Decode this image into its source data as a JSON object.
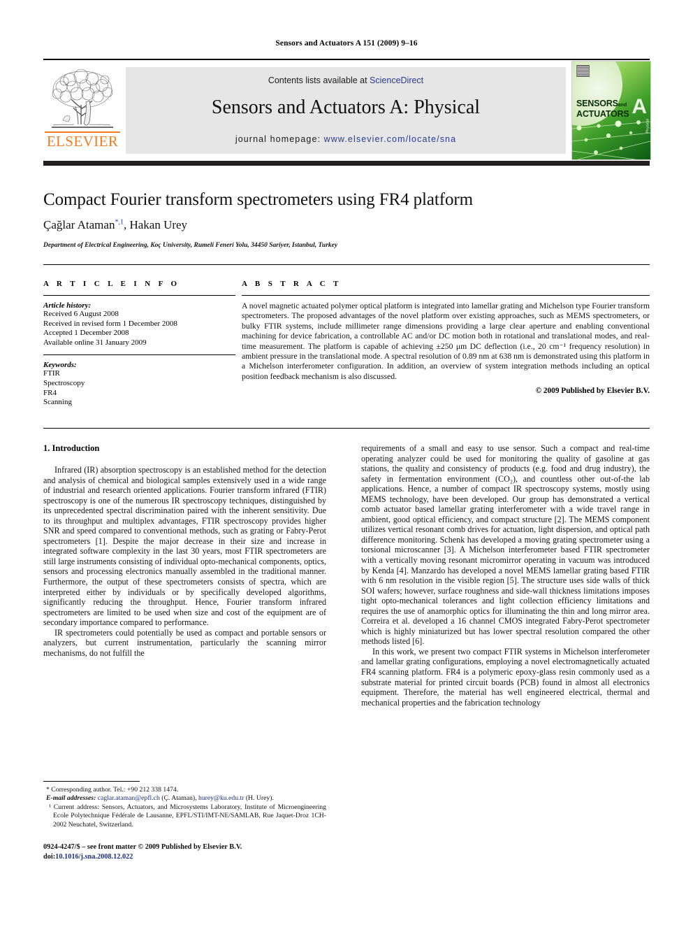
{
  "running_head": "Sensors and Actuators A 151 (2009) 9–16",
  "masthead": {
    "contents_prefix": "Contents lists available at ",
    "sciencedirect": "ScienceDirect",
    "journal_title": "Sensors and Actuators A: Physical",
    "homepage_prefix": "journal homepage: ",
    "homepage_url": "www.elsevier.com/locate/sna",
    "publisher_logo_text": "ELSEVIER",
    "cover": {
      "line1": "SENSORS",
      "line1_small": "and",
      "line2": "ACTUATORS",
      "letter": "A",
      "sub": "Physical"
    },
    "colors": {
      "link": "#2b3b8f",
      "elsevier_orange": "#f47c20",
      "box_gray": "#e6e6e6"
    }
  },
  "article": {
    "title": "Compact Fourier transform spectrometers using FR4 platform",
    "authors_html": "Çağlar Ataman<sup class=\"star\">*,1</sup>, Hakan Urey",
    "authors_plain": "Çağlar Ataman*,1, Hakan Urey",
    "affiliation": "Department of Electrical Engineering, Koç University, Rumeli Feneri Yolu, 34450 Sariyer, Istanbul, Turkey"
  },
  "info": {
    "heading": "A R T I C L E   I N F O",
    "history_label": "Article history:",
    "history": [
      "Received 6 August 2008",
      "Received in revised form 1 December 2008",
      "Accepted 1 December 2008",
      "Available online 31 January 2009"
    ],
    "keywords_label": "Keywords:",
    "keywords": [
      "FTIR",
      "Spectroscopy",
      "FR4",
      "Scanning"
    ]
  },
  "abstract": {
    "heading": "A B S T R A C T",
    "text": "A novel magnetic actuated polymer optical platform is integrated into lamellar grating and Michelson type Fourier transform spectrometers. The proposed advantages of the novel platform over existing approaches, such as MEMS spectrometers, or bulky FTIR systems, include millimeter range dimensions providing a large clear aperture and enabling conventional machining for device fabrication, a controllable AC and/or DC motion both in rotational and translational modes, and real-time measurement. The platform is capable of achieving ±250 μm DC deflection (i.e., 20 cm⁻¹ frequency resolution) in ambient pressure in the translational mode. A spectral resolution of 0.89 nm at 638 nm is demonstrated using this platform in a Michelson interferometer configuration. In addition, an overview of system integration methods including an optical position feedback mechanism is also discussed.",
    "copyright": "© 2009 Published by Elsevier B.V."
  },
  "body": {
    "section1_title": "1. Introduction",
    "left_paragraphs": [
      "Infrared (IR) absorption spectroscopy is an established method for the detection and analysis of chemical and biological samples extensively used in a wide range of industrial and research oriented applications. Fourier transform infrared (FTIR) spectroscopy is one of the numerous IR spectroscopy techniques, distinguished by its unprecedented spectral discrimination paired with the inherent sensitivity. Due to its throughput and multiplex advantages, FTIR spectroscopy provides higher SNR and speed compared to conventional methods, such as grating or Fabry-Perot spectrometers [1]. Despite the major decrease in their size and increase in integrated software complexity in the last 30 years, most FTIR spectrometers are still large instruments consisting of individual opto-mechanical components, optics, sensors and processing electronics manually assembled in the traditional manner. Furthermore, the output of these spectrometers consists of spectra, which are interpreted either by individuals or by specifically developed algorithms, significantly reducing the throughput. Hence, Fourier transform infrared spectrometers are limited to be used when size and cost of the equipment are of secondary importance compared to performance.",
      "IR spectrometers could potentially be used as compact and portable sensors or analyzers, but current instrumentation, particularly the scanning mirror mechanisms, do not fulfill the"
    ],
    "right_paragraphs": [
      "requirements of a small and easy to use sensor. Such a compact and real-time operating analyzer could be used for monitoring the quality of gasoline at gas stations, the quality and consistency of products (e.g. food and drug industry), the safety in fermentation environment (CO₂), and countless other out-of-the lab applications. Hence, a number of compact IR spectroscopy systems, mostly using MEMS technology, have been developed. Our group has demonstrated a vertical comb actuator based lamellar grating interferometer with a wide travel range in ambient, good optical efficiency, and compact structure [2]. The MEMS component utilizes vertical resonant comb drives for actuation, light dispersion, and optical path difference monitoring. Schenk has developed a moving grating spectrometer using a torsional microscanner [3]. A Michelson interferometer based FTIR spectrometer with a vertically moving resonant micromirror operating in vacuum was introduced by Kenda [4]. Manzardo has developed a novel MEMS lamellar grating based FTIR with 6 nm resolution in the visible region [5]. The structure uses side walls of thick SOI wafers; however, surface roughness and side-wall thickness limitations imposes tight opto-mechanical tolerances and light collection efficiency limitations and requires the use of anamorphic optics for illuminating the thin and long mirror area. Correira et al. developed a 16 channel CMOS integrated Fabry-Perot spectrometer which is highly miniaturized but has lower spectral resolution compared the other methods listed [6].",
      "In this work, we present two compact FTIR systems in Michelson interferometer and lamellar grating configurations, employing a novel electromagnetically actuated FR4 scanning platform. FR4 is a polymeric epoxy-glass resin commonly used as a substrate material for printed circuit boards (PCB) found in almost all electronics equipment. Therefore, the material has well engineered electrical, thermal and mechanical properties and the fabrication technology"
    ]
  },
  "footnotes": {
    "corresponding": "* Corresponding author. Tel.: +90 212 338 1474.",
    "email_label": "E-mail addresses:",
    "email1": "caglar.ataman@epfl.ch",
    "email1_who": " (Ç. Ataman),",
    "email2": "hurey@ku.edu.tr",
    "email2_who": " (H. Urey).",
    "current_address": "¹ Current address: Sensors, Actuators, and Microsystems Laboratory, Institute of Microengineering Ecole Polytechnique Fédérale de Lausanne, EPFL/STI/IMT-NE/SAMLAB, Rue Jaquet-Droz 1CH-2002 Neuchatel, Switzerland.",
    "issn_line": "0924-4247/$ – see front matter © 2009 Published by Elsevier B.V.",
    "doi_label": "doi:",
    "doi_value": "10.1016/j.sna.2008.12.022"
  }
}
